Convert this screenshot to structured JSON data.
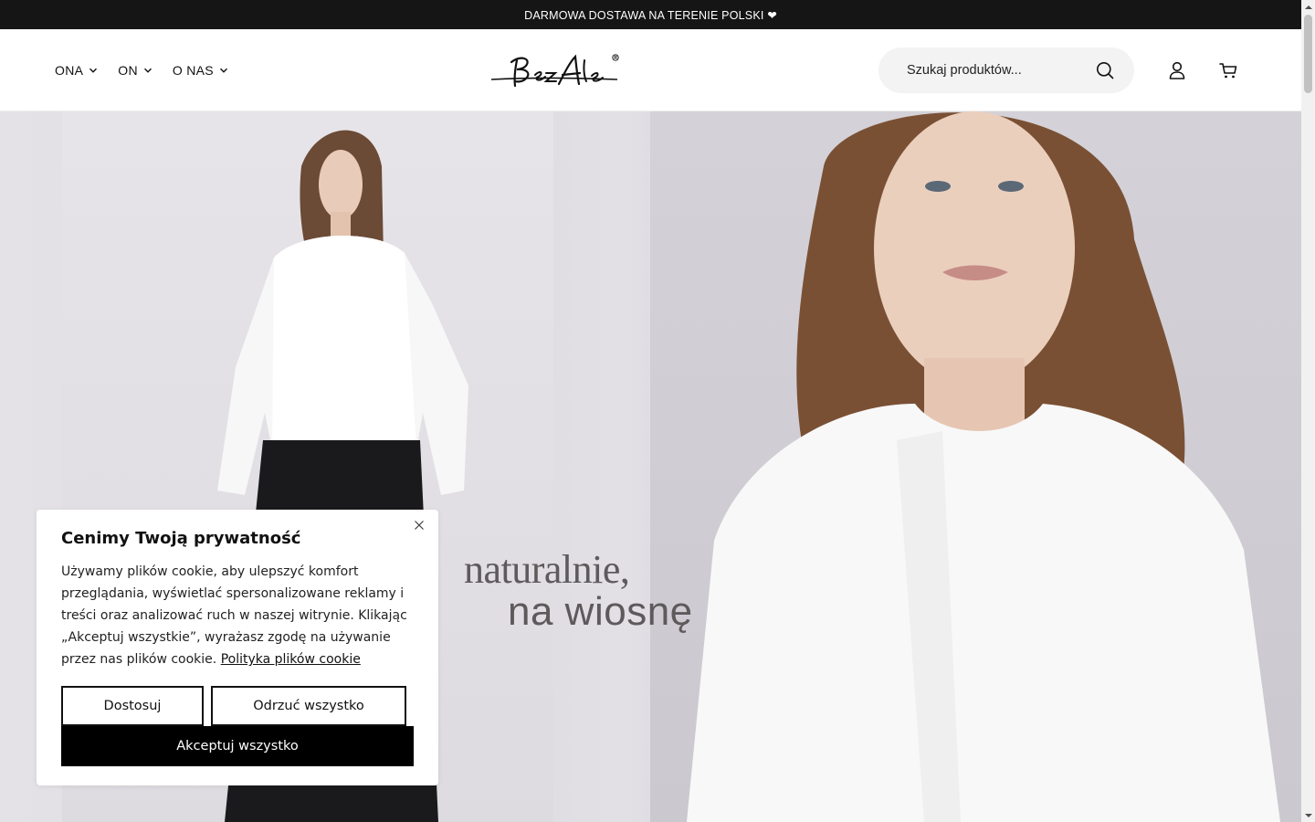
{
  "announcement": {
    "text": "DARMOWA DOSTAWA NA TERENIE POLSKI ❤"
  },
  "header": {
    "nav": [
      {
        "label": "ONA"
      },
      {
        "label": "ON"
      },
      {
        "label": "O NAS"
      }
    ],
    "logo": {
      "text": "BezAle"
    },
    "search": {
      "placeholder": "Szukaj produktów..."
    },
    "icons": {
      "search": "search-icon",
      "account": "user-icon",
      "cart": "cart-icon"
    }
  },
  "hero": {
    "line1": "naturalnie,",
    "line2": "na wiosnę"
  },
  "cookie": {
    "title": "Cenimy Twoją prywatność",
    "body": "Używamy plików cookie, aby ulepszyć komfort przeglądania, wyświetlać spersonalizowane reklamy i treści oraz analizować ruch w naszej witrynie. Klikając „Akceptuj wszystkie”, wyrażasz zgodę na używanie przez nas plików cookie.",
    "policy_link": "Polityka plików cookie",
    "btn_customize": "Dostosuj",
    "btn_reject": "Odrzuć wszystko",
    "btn_accept": "Akceptuj wszystko"
  },
  "colors": {
    "announcement_bg": "#151515",
    "accent": "#000000",
    "search_bg": "#f3f3f3"
  }
}
